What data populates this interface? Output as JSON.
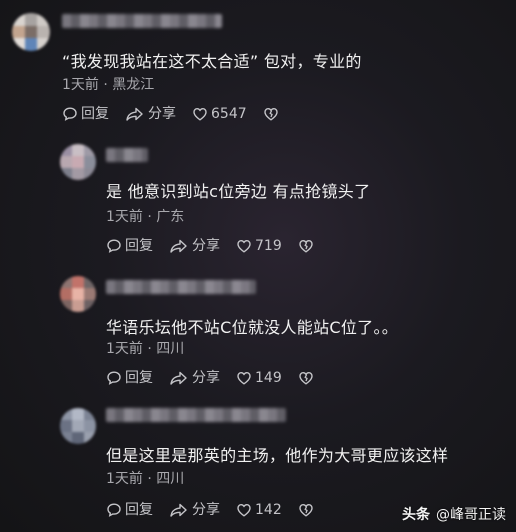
{
  "comments": [
    {
      "text": "“我发现我站在这不太合适” 包对，专业的",
      "meta": "1天前 · 黑龙江",
      "reply_label": "回复",
      "share_label": "分享",
      "likes": "6547"
    },
    {
      "text": "是 他意识到站c位旁边 有点抢镜头了",
      "meta": "1天前 · 广东",
      "reply_label": "回复",
      "share_label": "分享",
      "likes": "719"
    },
    {
      "text": "华语乐坛他不站C位就没人能站C位了。。",
      "meta": "1天前 · 四川",
      "reply_label": "回复",
      "share_label": "分享",
      "likes": "149"
    },
    {
      "text": "但是这里是那英的主场，他作为大哥更应该这样",
      "meta": "1天前 · 四川",
      "reply_label": "回复",
      "share_label": "分享",
      "likes": "142"
    }
  ],
  "watermark": {
    "brand": "头条",
    "handle": "@峰哥正读"
  },
  "colors": {
    "background": "#1b1a20",
    "text": "#f1f1f1",
    "meta": "#a8a8ad",
    "action": "#c4c4c8"
  },
  "icons": {
    "reply": "speech-bubble-icon",
    "share": "share-arrow-icon",
    "like": "heart-icon",
    "dislike": "broken-heart-icon"
  }
}
